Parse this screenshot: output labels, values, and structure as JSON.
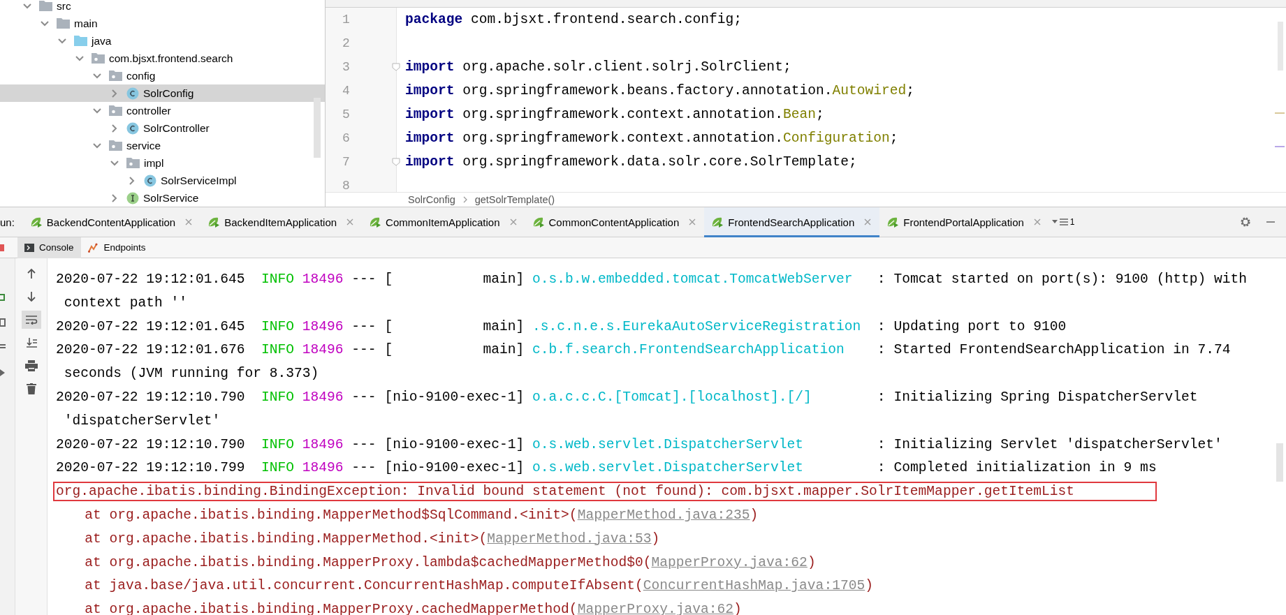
{
  "project_tree": [
    {
      "label": "src",
      "kind": "folder",
      "expanded": true,
      "selected": false,
      "children": [
        {
          "label": "main",
          "kind": "folder",
          "expanded": true,
          "selected": false,
          "children": [
            {
              "label": "java",
              "kind": "source_folder",
              "expanded": true,
              "selected": false,
              "children": [
                {
                  "label": "com.bjsxt.frontend.search",
                  "kind": "package",
                  "expanded": true,
                  "selected": false,
                  "children": [
                    {
                      "label": "config",
                      "kind": "package",
                      "expanded": true,
                      "selected": false,
                      "children": [
                        {
                          "label": "SolrConfig",
                          "kind": "class",
                          "expanded": false,
                          "selected": true
                        }
                      ]
                    },
                    {
                      "label": "controller",
                      "kind": "package",
                      "expanded": true,
                      "selected": false,
                      "children": [
                        {
                          "label": "SolrController",
                          "kind": "class",
                          "expanded": false,
                          "selected": false
                        }
                      ]
                    },
                    {
                      "label": "service",
                      "kind": "package",
                      "expanded": true,
                      "selected": false,
                      "children": [
                        {
                          "label": "impl",
                          "kind": "package",
                          "expanded": true,
                          "selected": false,
                          "children": [
                            {
                              "label": "SolrServiceImpl",
                              "kind": "class",
                              "expanded": false,
                              "selected": false
                            }
                          ]
                        },
                        {
                          "label": "SolrService",
                          "kind": "interface",
                          "expanded": false,
                          "selected": false
                        }
                      ]
                    }
                  ]
                }
              ]
            }
          ]
        }
      ]
    }
  ],
  "editor": {
    "lines": [
      {
        "number": "1",
        "fold": false,
        "segments": [
          {
            "kind": "keyword",
            "text": "package"
          },
          {
            "kind": "plain",
            "text": " com.bjsxt.frontend.search.config;"
          }
        ]
      },
      {
        "number": "2",
        "fold": false
      },
      {
        "number": "3",
        "fold": true,
        "segments": [
          {
            "kind": "keyword",
            "text": "import"
          },
          {
            "kind": "plain",
            "text": " org.apache.solr.client.solrj.SolrClient;"
          }
        ]
      },
      {
        "number": "4",
        "fold": false,
        "segments": [
          {
            "kind": "keyword",
            "text": "import"
          },
          {
            "kind": "plain",
            "text": " org.springframework.beans.factory.annotation."
          },
          {
            "kind": "annotation",
            "text": "Autowired"
          },
          {
            "kind": "plain",
            "text": ";"
          }
        ]
      },
      {
        "number": "5",
        "fold": false,
        "segments": [
          {
            "kind": "keyword",
            "text": "import"
          },
          {
            "kind": "plain",
            "text": " org.springframework.context.annotation."
          },
          {
            "kind": "annotation",
            "text": "Bean"
          },
          {
            "kind": "plain",
            "text": ";"
          }
        ]
      },
      {
        "number": "6",
        "fold": false,
        "segments": [
          {
            "kind": "keyword",
            "text": "import"
          },
          {
            "kind": "plain",
            "text": " org.springframework.context.annotation."
          },
          {
            "kind": "annotation",
            "text": "Configuration"
          },
          {
            "kind": "plain",
            "text": ";"
          }
        ]
      },
      {
        "number": "7",
        "fold": true,
        "segments": [
          {
            "kind": "keyword",
            "text": "import"
          },
          {
            "kind": "plain",
            "text": " org.springframework.data.solr.core.SolrTemplate;"
          }
        ]
      },
      {
        "number": "8",
        "fold": false
      }
    ],
    "breadcrumbs": [
      "SolrConfig",
      "getSolrTemplate()"
    ]
  },
  "run_panel": {
    "label": "un:",
    "tabs": [
      {
        "label": "BackendContentApplication",
        "selected": false
      },
      {
        "label": "BackendItemApplication",
        "selected": false
      },
      {
        "label": "CommonItemApplication",
        "selected": false
      },
      {
        "label": "CommonContentApplication",
        "selected": false
      },
      {
        "label": "FrontendSearchApplication",
        "selected": true
      },
      {
        "label": "FrontendPortalApplication",
        "selected": false
      }
    ],
    "overflow_count": "1",
    "subtabs": [
      {
        "label": "Console",
        "selected": true
      },
      {
        "label": "Endpoints",
        "selected": false
      }
    ]
  },
  "console": [
    {
      "kind": "log",
      "time": "2020-07-22 19:12:01.645",
      "level": "INFO",
      "pid": "18496",
      "thread": "--- [           main]",
      "logger": "o.s.b.w.embedded.tomcat.TomcatWebServer",
      "message": ": Tomcat started on port(s): 9100 (http) with"
    },
    {
      "kind": "wrap",
      "text": "context path ''"
    },
    {
      "kind": "log",
      "time": "2020-07-22 19:12:01.645",
      "level": "INFO",
      "pid": "18496",
      "thread": "--- [           main]",
      "logger": ".s.c.n.e.s.EurekaAutoServiceRegistration",
      "message": ": Updating port to 9100"
    },
    {
      "kind": "log",
      "time": "2020-07-22 19:12:01.676",
      "level": "INFO",
      "pid": "18496",
      "thread": "--- [           main]",
      "logger": "c.b.f.search.FrontendSearchApplication",
      "message": ": Started FrontendSearchApplication in 7.74"
    },
    {
      "kind": "wrap",
      "text": "seconds (JVM running for 8.373)"
    },
    {
      "kind": "log",
      "time": "2020-07-22 19:12:10.790",
      "level": "INFO",
      "pid": "18496",
      "thread": "--- [nio-9100-exec-1]",
      "logger": "o.a.c.c.C.[Tomcat].[localhost].[/]",
      "message": ": Initializing Spring DispatcherServlet"
    },
    {
      "kind": "wrap",
      "text": "'dispatcherServlet'"
    },
    {
      "kind": "log",
      "time": "2020-07-22 19:12:10.790",
      "level": "INFO",
      "pid": "18496",
      "thread": "--- [nio-9100-exec-1]",
      "logger": "o.s.web.servlet.DispatcherServlet",
      "message": ": Initializing Servlet 'dispatcherServlet'"
    },
    {
      "kind": "log",
      "time": "2020-07-22 19:12:10.799",
      "level": "INFO",
      "pid": "18496",
      "thread": "--- [nio-9100-exec-1]",
      "logger": "o.s.web.servlet.DispatcherServlet",
      "message": ": Completed initialization in 9 ms"
    },
    {
      "kind": "exception",
      "text": "org.apache.ibatis.binding.BindingException: Invalid bound statement (not found): com.bjsxt.mapper.SolrItemMapper.getItemList"
    },
    {
      "kind": "stack",
      "text": "at org.apache.ibatis.binding.MapperMethod$SqlCommand.<init>(",
      "link": "MapperMethod.java:235",
      "tail": ")"
    },
    {
      "kind": "stack",
      "text": "at org.apache.ibatis.binding.MapperMethod.<init>(",
      "link": "MapperMethod.java:53",
      "tail": ")"
    },
    {
      "kind": "stack",
      "text": "at org.apache.ibatis.binding.MapperProxy.lambda$cachedMapperMethod$0(",
      "link": "MapperProxy.java:62",
      "tail": ")"
    },
    {
      "kind": "stack",
      "text": "at java.base/java.util.concurrent.ConcurrentHashMap.computeIfAbsent(",
      "link": "ConcurrentHashMap.java:1705",
      "tail": ")"
    },
    {
      "kind": "stack",
      "text": "at org.apache.ibatis.binding.MapperProxy.cachedMapperMethod(",
      "link": "MapperProxy.java:62",
      "tail": ")"
    }
  ]
}
